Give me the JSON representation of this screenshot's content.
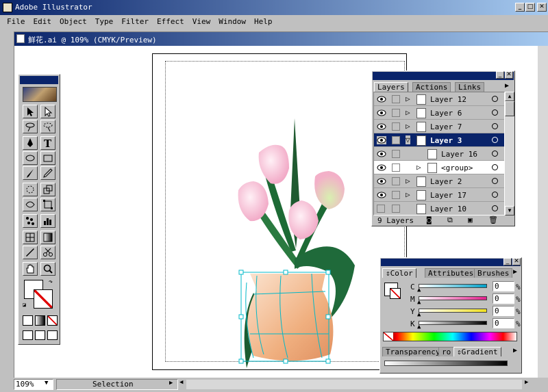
{
  "app": {
    "title": "Adobe Illustrator"
  },
  "menu": [
    "File",
    "Edit",
    "Object",
    "Type",
    "Filter",
    "Effect",
    "View",
    "Window",
    "Help"
  ],
  "document": {
    "title": "鲜花.ai @ 109% (CMYK/Preview)"
  },
  "layers_panel": {
    "tabs": [
      "Layers",
      "Actions",
      "Links"
    ],
    "rows": [
      {
        "name": "Layer 12",
        "state": "normal",
        "expandable": true
      },
      {
        "name": "Layer 6",
        "state": "normal",
        "expandable": true
      },
      {
        "name": "Layer 7",
        "state": "normal",
        "expandable": true
      },
      {
        "name": "Layer 3",
        "state": "selected",
        "expandable": true
      },
      {
        "name": "Layer 16",
        "state": "sublayer",
        "expandable": false
      },
      {
        "name": "<group>",
        "state": "group",
        "expandable": true
      },
      {
        "name": "Layer 2",
        "state": "normal",
        "expandable": true
      },
      {
        "name": "Layer 17",
        "state": "normal",
        "expandable": true
      },
      {
        "name": "Layer 10",
        "state": "normal",
        "expandable": false
      }
    ],
    "count": "9 Layers"
  },
  "color_panel": {
    "tabs": [
      "Color",
      "Attributes",
      "Brushes"
    ],
    "channels": [
      {
        "label": "C",
        "value": "0",
        "unit": "%",
        "color": "#00a0c8"
      },
      {
        "label": "M",
        "value": "0",
        "unit": "%",
        "color": "#e0208c"
      },
      {
        "label": "Y",
        "value": "0",
        "unit": "%",
        "color": "#f0e020"
      },
      {
        "label": "K",
        "value": "0",
        "unit": "%",
        "color": "#000000"
      }
    ]
  },
  "transparency_panel": {
    "tabs": [
      "Transparency",
      "ro",
      "Gradient"
    ]
  },
  "status": {
    "zoom": "109%",
    "tool": "Selection"
  }
}
